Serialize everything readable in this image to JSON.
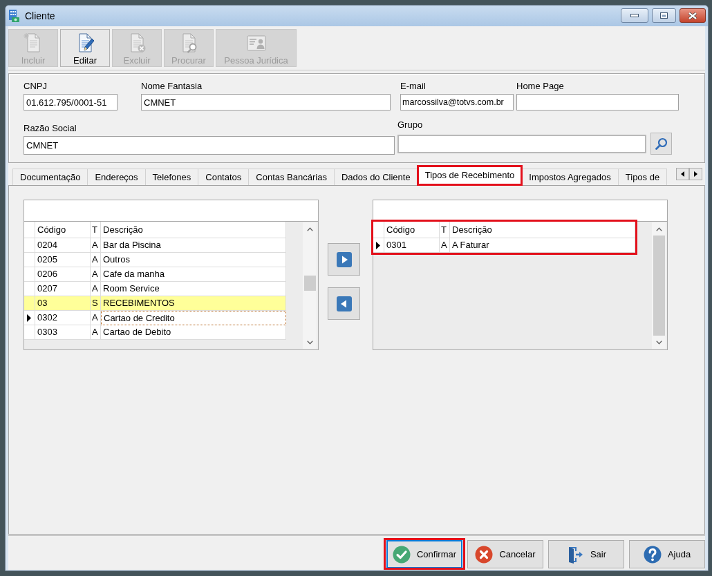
{
  "window": {
    "title": "Cliente"
  },
  "toolbar": [
    {
      "label": "Incluir",
      "kind": "new",
      "disabled": true
    },
    {
      "label": "Editar",
      "kind": "edit",
      "disabled": false
    },
    {
      "label": "Excluir",
      "kind": "delete",
      "disabled": true
    },
    {
      "label": "Procurar",
      "kind": "find",
      "disabled": true
    },
    {
      "label": "Pessoa Jurídica",
      "kind": "company",
      "disabled": true
    }
  ],
  "form": {
    "fields": [
      {
        "label": "CNPJ",
        "kind": "text",
        "value": "01.612.795/0001-51"
      },
      {
        "label": "Nome Fantasia",
        "kind": "text",
        "value": "CMNET"
      },
      {
        "label": "E-mail",
        "kind": "text",
        "value": "marcossilva@totvs.com.br"
      },
      {
        "label": "Home Page",
        "kind": "text"
      },
      {
        "label": "Razão Social",
        "kind": "text",
        "value": "CMNET"
      },
      {
        "label": "Grupo",
        "kind": "lookup"
      }
    ]
  },
  "tabs": [
    {
      "label": "Documentação",
      "selected": false,
      "highlighted": false
    },
    {
      "label": "Endereços",
      "selected": false,
      "highlighted": false
    },
    {
      "label": "Telefones",
      "selected": false,
      "highlighted": false
    },
    {
      "label": "Contatos",
      "selected": false,
      "highlighted": false
    },
    {
      "label": "Contas Bancárias",
      "selected": false,
      "highlighted": false
    },
    {
      "label": "Dados do Cliente",
      "selected": false,
      "highlighted": false
    },
    {
      "label": "Tipos de Recebimento",
      "selected": true,
      "highlighted": true
    },
    {
      "label": "Impostos Agregados",
      "selected": false,
      "highlighted": false
    },
    {
      "label": "Tipos de",
      "selected": false,
      "highlighted": false
    }
  ],
  "lists": [
    {
      "highlighted": false,
      "columns": [
        "Código",
        "T",
        "Descrição"
      ],
      "rows": [
        {
          "code": "0204",
          "type": "A",
          "description": "Bar da Piscina",
          "kind": "entry",
          "current": false,
          "focused": false
        },
        {
          "code": "0205",
          "type": "A",
          "description": "Outros",
          "kind": "entry",
          "current": false,
          "focused": false
        },
        {
          "code": "0206",
          "type": "A",
          "description": "Cafe da manha",
          "kind": "entry",
          "current": false,
          "focused": false
        },
        {
          "code": "0207",
          "type": "A",
          "description": "Room Service",
          "kind": "entry",
          "current": false,
          "focused": false
        },
        {
          "code": "03",
          "type": "S",
          "description": "RECEBIMENTOS",
          "kind": "group",
          "current": false,
          "focused": false
        },
        {
          "code": "0302",
          "type": "A",
          "description": "Cartao de Credito",
          "kind": "entry",
          "current": true,
          "focused": true
        },
        {
          "code": "0303",
          "type": "A",
          "description": "Cartao de Debito",
          "kind": "entry",
          "current": false,
          "focused": false
        }
      ]
    },
    {
      "highlighted": true,
      "columns": [
        "Código",
        "T",
        "Descrição"
      ],
      "rows": [
        {
          "code": "0301",
          "type": "A",
          "description": "A Faturar",
          "kind": "entry",
          "current": true,
          "focused": false
        }
      ]
    }
  ],
  "buttons": [
    {
      "label": "Confirmar",
      "kind": "confirm",
      "focused": true,
      "highlighted": true
    },
    {
      "label": "Cancelar",
      "kind": "cancel",
      "focused": false,
      "highlighted": false
    },
    {
      "label": "Sair",
      "kind": "exit",
      "focused": false,
      "highlighted": false
    },
    {
      "label": "Ajuda",
      "kind": "help",
      "focused": false,
      "highlighted": false
    }
  ]
}
